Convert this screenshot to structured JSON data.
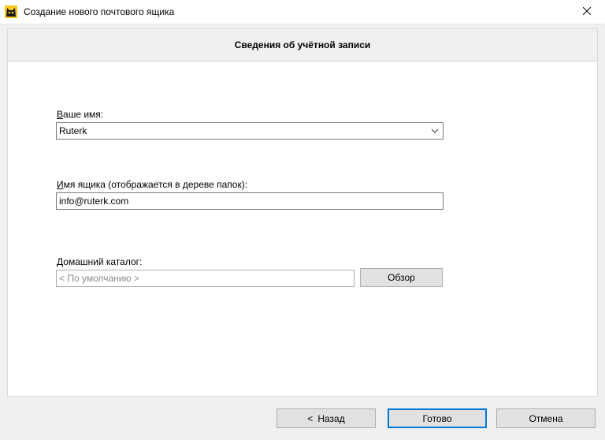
{
  "window": {
    "title": "Создание нового почтового ящика",
    "app_icon": "cat-app-icon",
    "close_icon": "close-icon"
  },
  "panel": {
    "header": "Сведения об учётной записи"
  },
  "form": {
    "name_label_access": "В",
    "name_label_rest": "аше имя:",
    "name_value": "Ruterk",
    "mailbox_label_access": "И",
    "mailbox_label_rest": "мя ящика (отображается в дереве папок):",
    "mailbox_value": "info@ruterk.com",
    "home_label_access": "Д",
    "home_label_rest": "омашний каталог:",
    "home_placeholder": "< По умолчанию >",
    "browse_label": "Обзор"
  },
  "buttons": {
    "back_arrow": "<",
    "back_label": "Назад",
    "done_label": "Готово",
    "cancel_label": "Отмена"
  },
  "colors": {
    "accent": "#0078d7",
    "window_bg": "#f0f0f0"
  }
}
